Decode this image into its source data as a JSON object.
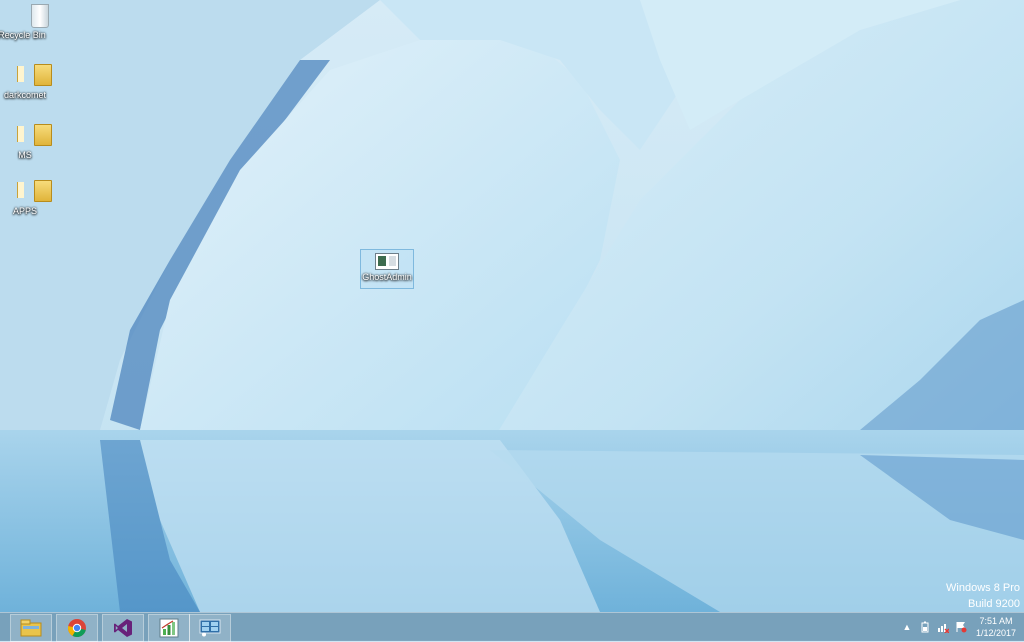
{
  "desktop": {
    "icons": [
      {
        "label": "Recycle Bin"
      },
      {
        "label": "darkcomet"
      },
      {
        "label": "MS"
      },
      {
        "label": "APPS"
      },
      {
        "label": "GhostAdmin"
      }
    ]
  },
  "watermark": {
    "line1": "Windows 8 Pro",
    "line2": "Build 9200"
  },
  "taskbar": {
    "apps": [
      {
        "icon": "file-explorer-icon"
      },
      {
        "icon": "chrome-icon"
      },
      {
        "icon": "visual-studio-icon"
      },
      {
        "icon": "app-chart-icon"
      },
      {
        "icon": "ghostadmin-icon"
      }
    ],
    "clock": {
      "time": "7:51 AM",
      "date": "1/12/2017"
    },
    "tray_chevron": "▲"
  },
  "colors": {
    "taskbar": "#78a0b9",
    "accent_purple": "#68217a",
    "folder": "#e8c04a"
  }
}
